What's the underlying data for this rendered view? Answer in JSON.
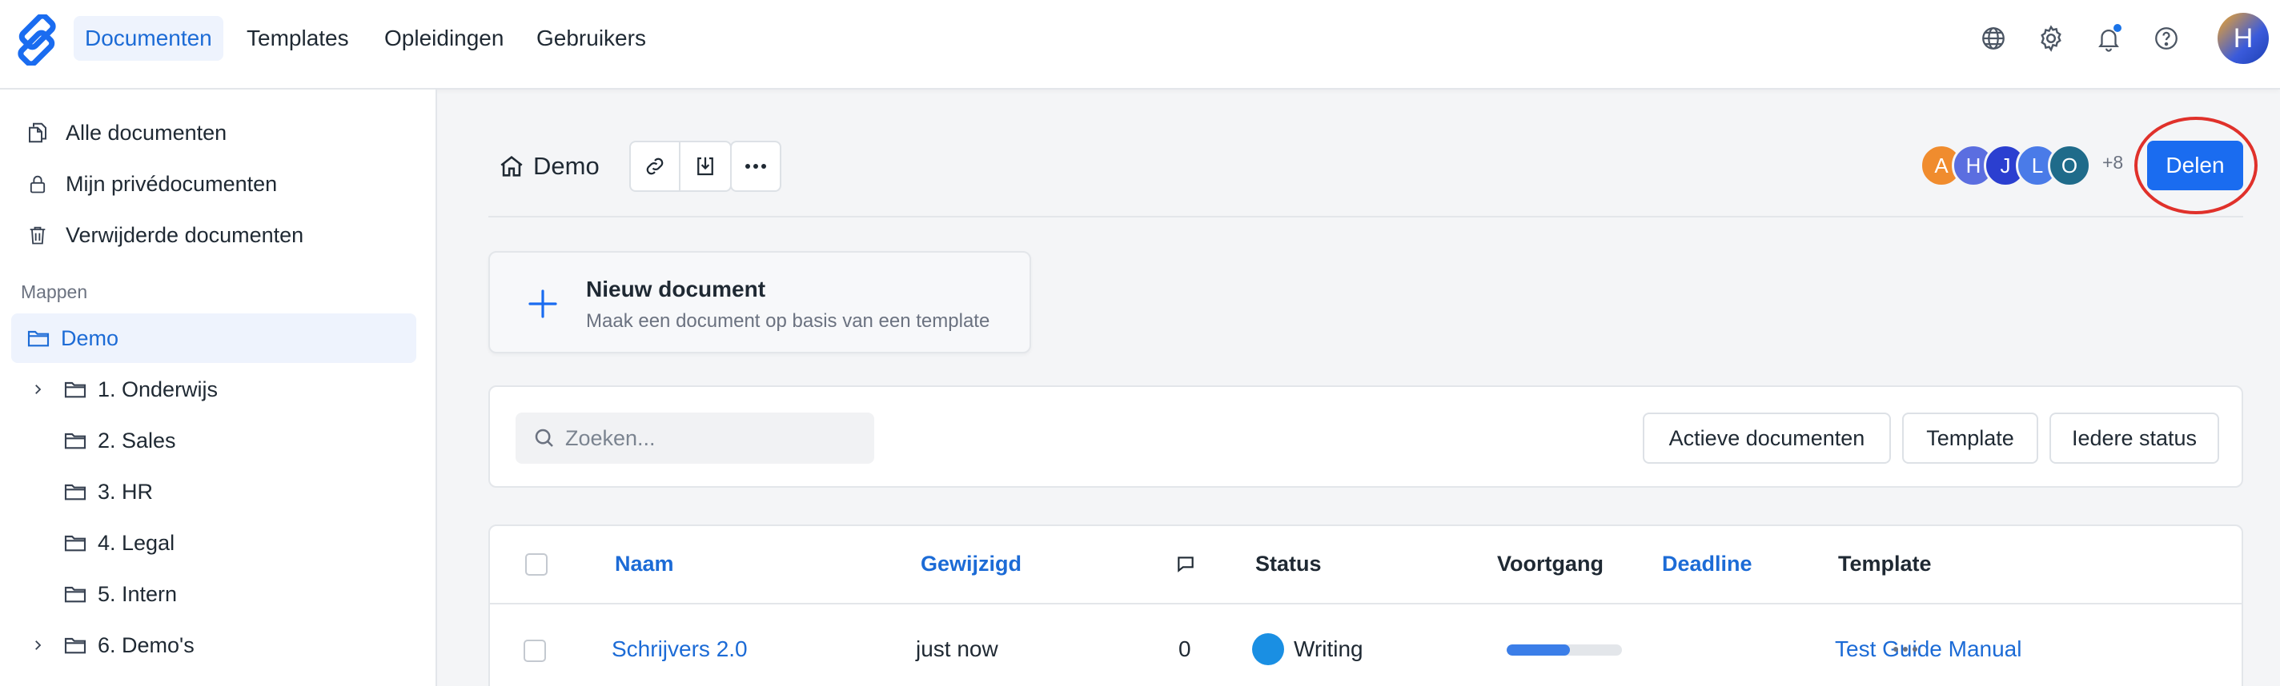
{
  "topnav": {
    "tabs": [
      {
        "label": "Documenten",
        "active": true
      },
      {
        "label": "Templates",
        "active": false
      },
      {
        "label": "Opleidingen",
        "active": false
      },
      {
        "label": "Gebruikers",
        "active": false
      }
    ],
    "icons": [
      "globe-icon",
      "gear-icon",
      "bell-icon",
      "help-icon"
    ],
    "user_initial": "H"
  },
  "sidebar": {
    "items": [
      {
        "label": "Alle documenten",
        "icon": "documents-icon"
      },
      {
        "label": "Mijn privédocumenten",
        "icon": "lock-icon"
      },
      {
        "label": "Verwijderde documenten",
        "icon": "trash-icon"
      }
    ],
    "folders_heading": "Mappen",
    "folders": [
      {
        "label": "Demo",
        "active": true,
        "expandable": false
      },
      {
        "label": "1. Onderwijs",
        "active": false,
        "expandable": true
      },
      {
        "label": "2. Sales",
        "active": false,
        "expandable": false
      },
      {
        "label": "3. HR",
        "active": false,
        "expandable": false
      },
      {
        "label": "4. Legal",
        "active": false,
        "expandable": false
      },
      {
        "label": "5. Intern",
        "active": false,
        "expandable": false
      },
      {
        "label": "6. Demo's",
        "active": false,
        "expandable": true
      }
    ]
  },
  "header": {
    "title": "Demo",
    "members": [
      {
        "initial": "A",
        "color": "#f08c2e"
      },
      {
        "initial": "H",
        "color": "#5b6ee0"
      },
      {
        "initial": "J",
        "color": "#2b3fd0"
      },
      {
        "initial": "L",
        "color": "#4a7be8"
      },
      {
        "initial": "O",
        "color": "#1f6b8a"
      }
    ],
    "extra_members": "+8",
    "share_label": "Delen"
  },
  "new_document": {
    "title": "Nieuw document",
    "subtitle": "Maak een document op basis van een template"
  },
  "filters": {
    "search_placeholder": "Zoeken...",
    "buttons": [
      "Actieve documenten",
      "Template",
      "Iedere status"
    ]
  },
  "table": {
    "columns": {
      "name": "Naam",
      "modified": "Gewijzigd",
      "status": "Status",
      "progress": "Voortgang",
      "deadline": "Deadline",
      "template": "Template"
    },
    "rows": [
      {
        "name": "Schrijvers 2.0",
        "modified": "just now",
        "comments": "0",
        "status": "Writing",
        "progress": 0.55,
        "deadline": "",
        "template": "Test Guide Manual"
      }
    ]
  },
  "colors": {
    "accent": "#1a6cf0",
    "link": "#1c6bd6",
    "highlight_ring": "#e0312b",
    "status_writing": "#1a8fe3"
  }
}
